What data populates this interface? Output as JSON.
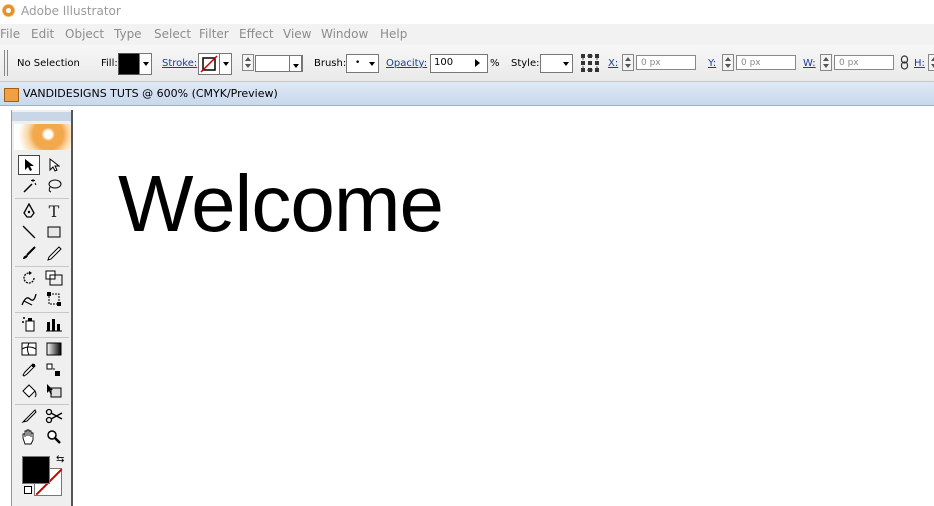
{
  "window": {
    "title": "Adobe Illustrator"
  },
  "menubar": {
    "items": [
      "File",
      "Edit",
      "Object",
      "Type",
      "Select",
      "Filter",
      "Effect",
      "View",
      "Window",
      "Help"
    ]
  },
  "controlbar": {
    "selection": "No Selection",
    "fill_label": "Fill:",
    "stroke_label": "Stroke:",
    "brush_label": "Brush:",
    "opacity_label": "Opacity:",
    "opacity_value": "100",
    "percent": "%",
    "style_label": "Style:",
    "x_label": "X:",
    "x_value": "0 px",
    "y_label": "Y:",
    "y_value": "0 px",
    "w_label": "W:",
    "w_value": "0 px",
    "h_label": "H:"
  },
  "document": {
    "tab_title": "VANDIDESIGNS TUTS @ 600% (CMYK/Preview)"
  },
  "canvas": {
    "text": "Welcome"
  },
  "colors": {
    "fill": "#000000",
    "stroke": "none",
    "menu_text": "#8c8c8c",
    "link": "#1a3d99"
  },
  "toolbox": {
    "tools": [
      "selection-tool",
      "direct-selection-tool",
      "magic-wand-tool",
      "lasso-tool",
      "pen-tool",
      "type-tool",
      "line-segment-tool",
      "rectangle-tool",
      "paintbrush-tool",
      "pencil-tool",
      "rotate-tool",
      "scale-tool",
      "warp-tool",
      "free-transform-tool",
      "symbol-sprayer-tool",
      "column-graph-tool",
      "mesh-tool",
      "gradient-tool",
      "eyedropper-tool",
      "blend-tool",
      "live-paint-bucket-tool",
      "live-paint-selection-tool",
      "slice-tool",
      "scissors-tool",
      "hand-tool",
      "zoom-tool"
    ],
    "glyphs": {
      "type": "T"
    }
  }
}
